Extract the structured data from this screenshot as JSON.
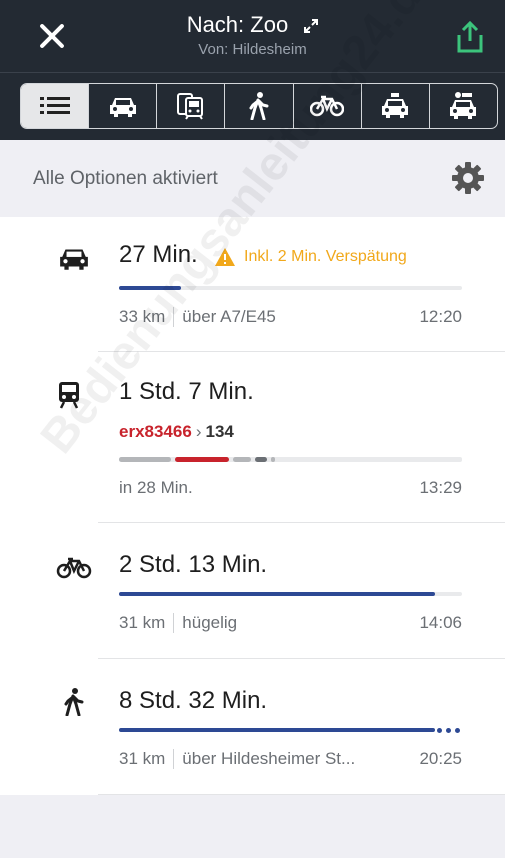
{
  "header": {
    "title": "Nach: Zoo",
    "subtitle": "Von: Hildesheim",
    "close_icon": "close-icon",
    "expand_icon": "expand-icon",
    "share_icon": "share-icon"
  },
  "modes": [
    {
      "name": "list",
      "icon": "list-icon",
      "active": true
    },
    {
      "name": "car",
      "icon": "car-icon",
      "active": false
    },
    {
      "name": "transit",
      "icon": "transit-icon",
      "active": false
    },
    {
      "name": "walk",
      "icon": "walk-icon",
      "active": false
    },
    {
      "name": "bike",
      "icon": "bike-icon",
      "active": false
    },
    {
      "name": "taxi",
      "icon": "taxi-icon",
      "active": false
    },
    {
      "name": "rideshare",
      "icon": "rideshare-icon",
      "active": false
    }
  ],
  "options": {
    "label": "Alle Optionen aktiviert",
    "icon": "gear-icon"
  },
  "routes": [
    {
      "mode": "car",
      "icon": "car-icon",
      "duration": "27 Min.",
      "delay": "Inkl. 2 Min. Verspätung",
      "progress": 0.18,
      "distance": "33 km",
      "via": "über A7/E45",
      "arrival": "12:20"
    },
    {
      "mode": "transit",
      "icon": "train-icon",
      "duration": "1 Std. 7 Min.",
      "line_primary": "erx83466",
      "line_secondary": "134",
      "status": "in 28 Min.",
      "arrival": "13:29"
    },
    {
      "mode": "bike",
      "icon": "bike-icon",
      "duration": "2 Std. 13 Min.",
      "progress": 0.92,
      "distance": "31 km",
      "via": "hügelig",
      "arrival": "14:06"
    },
    {
      "mode": "walk",
      "icon": "walk-icon",
      "duration": "8 Std. 32 Min.",
      "progress": 0.92,
      "distance": "31 km",
      "via": "über Hildesheimer St...",
      "arrival": "20:25"
    }
  ],
  "watermark": "Bedienungsanleitung24.de",
  "colors": {
    "header_bg": "#232a33",
    "accent_green": "#3cc47c",
    "route_blue": "#2d4994",
    "warning": "#f1a81b",
    "line_red": "#c8232c"
  }
}
